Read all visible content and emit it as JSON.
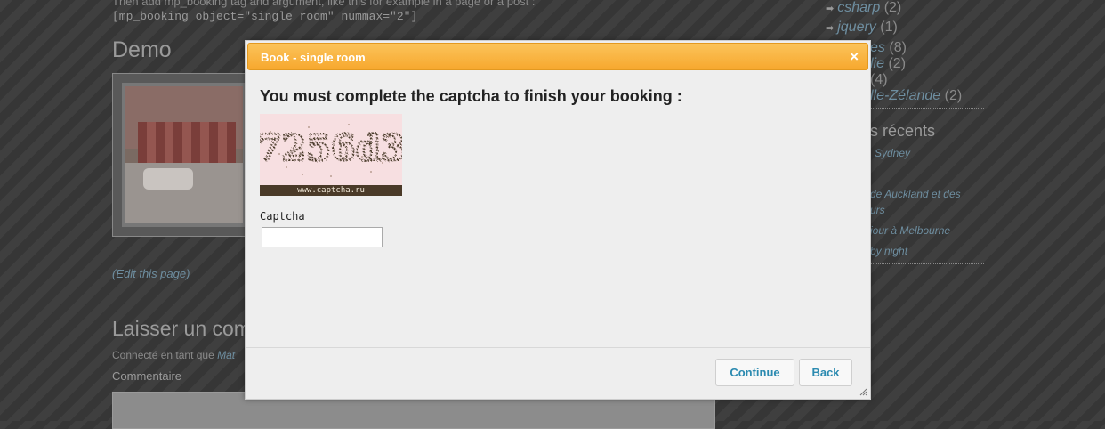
{
  "page": {
    "intro_text": "Then add mp_booking tag and argument, like this for example in a page or a post :",
    "shortcode": "[mp_booking object=\"single room\" nummax=\"2\"]",
    "demo_heading": "Demo",
    "edit_link": "(Edit this page)",
    "comment_heading": "Laisser un commentaire",
    "connected_prefix": "Connecté en tant que",
    "connected_user": "Mat",
    "comment_label": "Commentaire"
  },
  "sidebar": {
    "tags": [
      {
        "label": "csharp",
        "count": "(2)"
      },
      {
        "label": "jquery",
        "count": "(1)"
      },
      {
        "label": "es",
        "count": "(8)"
      },
      {
        "label": "lie",
        "count": "(2)"
      },
      {
        "label": "",
        "count": "(4)"
      },
      {
        "label": "lle-Zélande",
        "count": "(2)"
      }
    ],
    "recent_heading": "s récents",
    "recent_posts": [
      "Sydney",
      "de Auckland et des",
      "urs",
      "jour à Melbourne",
      "by night"
    ]
  },
  "dialog": {
    "title": "Book - single room",
    "close_glyph": "×",
    "heading": "You must complete the captcha to finish your booking :",
    "captcha_text": "7256d3",
    "captcha_footer": "www.captcha.ru",
    "captcha_label": "Captcha",
    "captcha_value": "",
    "buttons": {
      "continue": "Continue",
      "back": "Back"
    }
  },
  "colors": {
    "titlebar": "#f7a82e",
    "button_text": "#2b8ab0",
    "link": "#6e8ea0"
  }
}
